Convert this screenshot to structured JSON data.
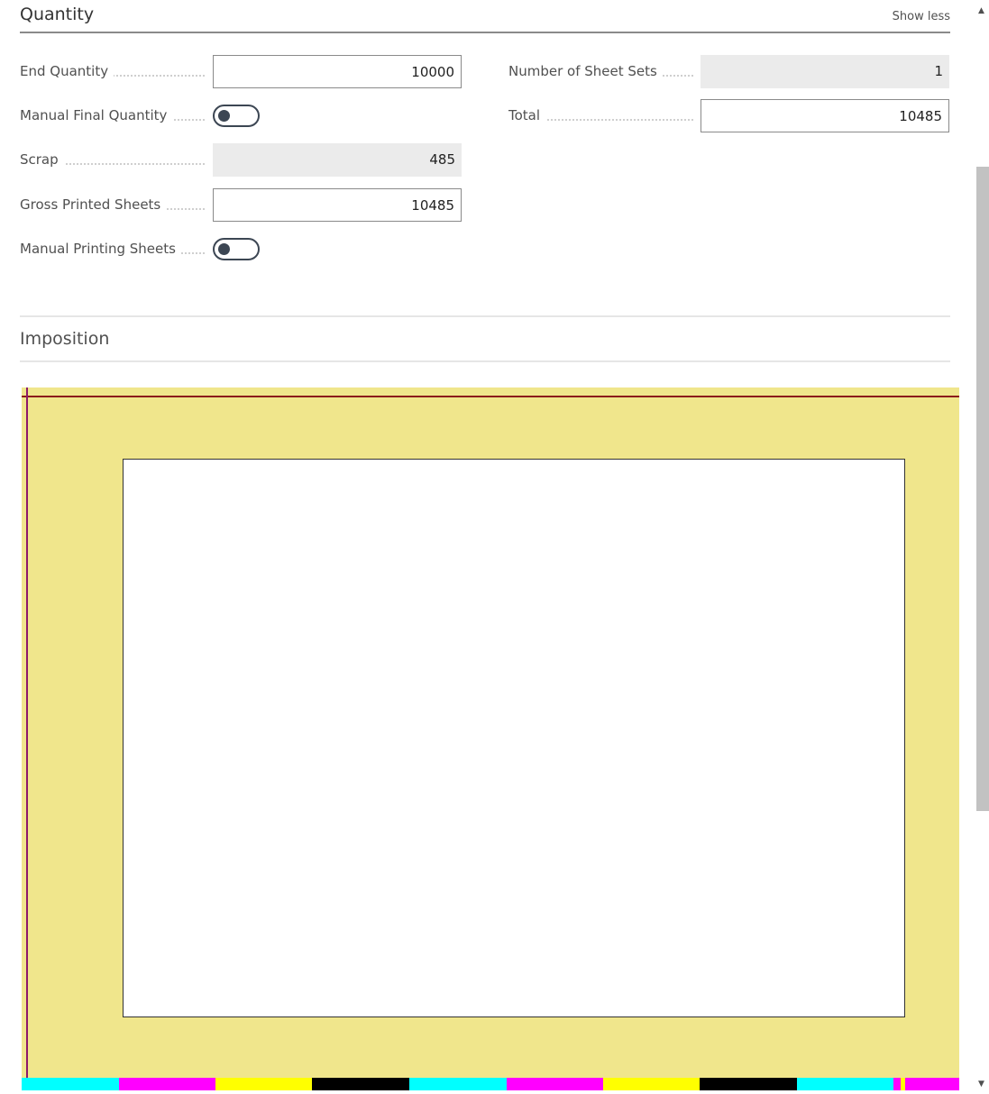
{
  "section": {
    "title": "Quantity",
    "show_less": "Show less"
  },
  "fields": {
    "end_quantity": {
      "label": "End Quantity",
      "value": "10000"
    },
    "manual_final_quantity": {
      "label": "Manual Final Quantity",
      "enabled": false
    },
    "scrap": {
      "label": "Scrap",
      "value": "485"
    },
    "gross_printed_sheets": {
      "label": "Gross Printed Sheets",
      "value": "10485"
    },
    "manual_printing_sheets": {
      "label": "Manual Printing Sheets",
      "enabled": false
    },
    "number_of_sheet_sets": {
      "label": "Number of Sheet Sets",
      "value": "1"
    },
    "total": {
      "label": "Total",
      "value": "10485"
    }
  },
  "imposition": {
    "title": "Imposition",
    "colors": {
      "sheet": "#f0e68c",
      "page": "#ffffff",
      "trim_line_h": "#8b1a1a",
      "trim_line_v": "#8b1a6a"
    },
    "color_bar": [
      "#00ffff",
      "#ff00ff",
      "#ffff00",
      "#000000",
      "#00ffff",
      "#ff00ff",
      "#ffff00",
      "#000000",
      "#00ffff",
      "#ff00ff",
      "#ffff00",
      "#ff00ff"
    ]
  },
  "scrollbar": {
    "up_icon": "triangle-up",
    "down_icon": "triangle-down"
  }
}
